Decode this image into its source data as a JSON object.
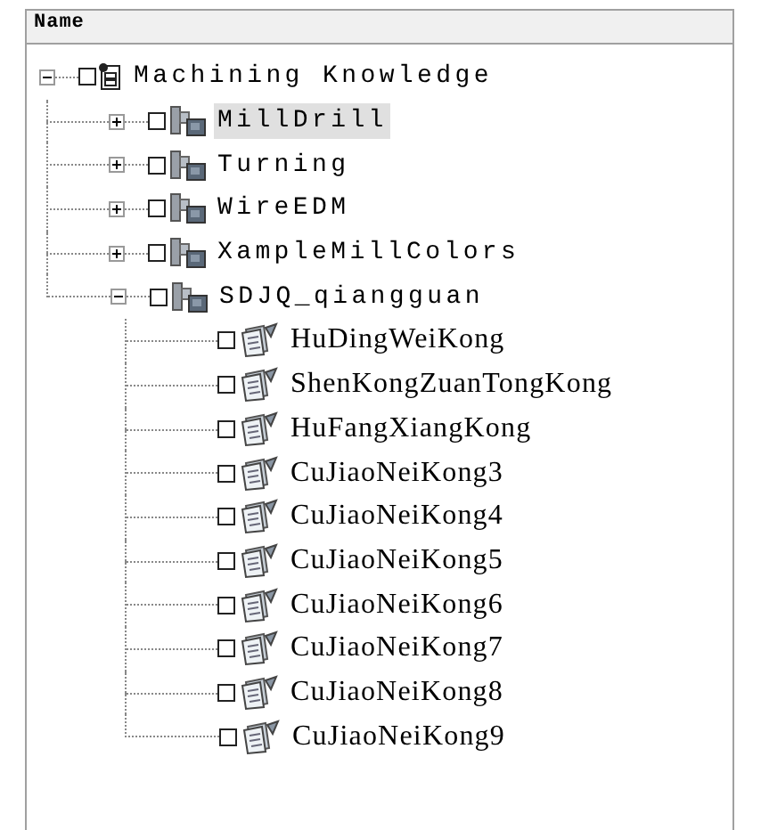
{
  "column_header": "Name",
  "tree": [
    {
      "label": "Machining Knowledge",
      "kind": "book",
      "expanded": true,
      "checked": false,
      "selected": false,
      "children": [
        {
          "label": "MillDrill",
          "kind": "group",
          "expanded": false,
          "checked": false,
          "selected": true
        },
        {
          "label": "Turning",
          "kind": "group",
          "expanded": false,
          "checked": false,
          "selected": false
        },
        {
          "label": "WireEDM",
          "kind": "group",
          "expanded": false,
          "checked": false,
          "selected": false
        },
        {
          "label": "XampleMillColors",
          "kind": "group",
          "expanded": false,
          "checked": false,
          "selected": false
        },
        {
          "label": "SDJQ_qiangguan",
          "kind": "group",
          "expanded": true,
          "checked": false,
          "selected": false,
          "children": [
            {
              "label": "HuDingWeiKong",
              "kind": "item",
              "checked": false,
              "selected": false
            },
            {
              "label": "ShenKongZuanTongKong",
              "kind": "item",
              "checked": false,
              "selected": false
            },
            {
              "label": "HuFangXiangKong",
              "kind": "item",
              "checked": false,
              "selected": false
            },
            {
              "label": "CuJiaoNeiKong3",
              "kind": "item",
              "checked": false,
              "selected": false
            },
            {
              "label": "CuJiaoNeiKong4",
              "kind": "item",
              "checked": false,
              "selected": false
            },
            {
              "label": "CuJiaoNeiKong5",
              "kind": "item",
              "checked": false,
              "selected": false
            },
            {
              "label": "CuJiaoNeiKong6",
              "kind": "item",
              "checked": false,
              "selected": false
            },
            {
              "label": "CuJiaoNeiKong7",
              "kind": "item",
              "checked": false,
              "selected": false
            },
            {
              "label": "CuJiaoNeiKong8",
              "kind": "item",
              "checked": false,
              "selected": false
            },
            {
              "label": "CuJiaoNeiKong9",
              "kind": "item",
              "checked": false,
              "selected": false
            }
          ]
        }
      ]
    }
  ]
}
